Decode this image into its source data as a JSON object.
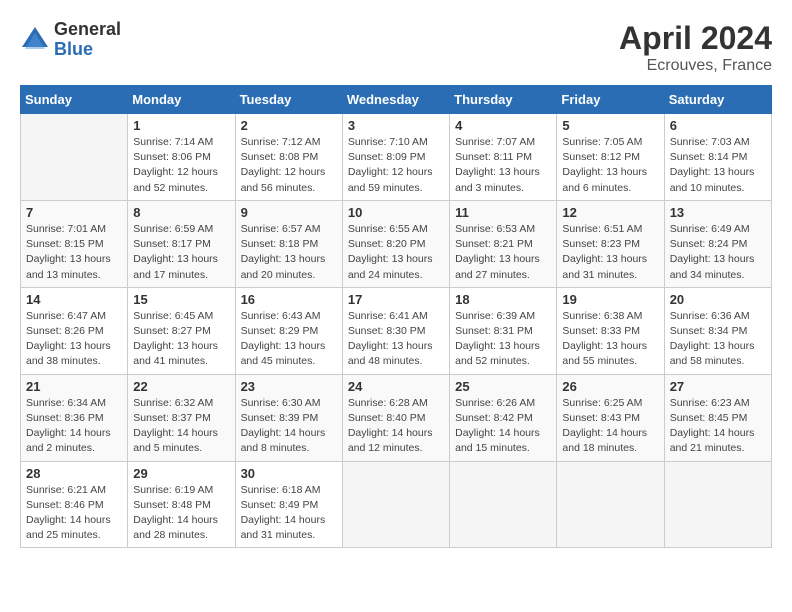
{
  "header": {
    "logo": {
      "general": "General",
      "blue": "Blue"
    },
    "title": "April 2024",
    "location": "Ecrouves, France"
  },
  "days_of_week": [
    "Sunday",
    "Monday",
    "Tuesday",
    "Wednesday",
    "Thursday",
    "Friday",
    "Saturday"
  ],
  "weeks": [
    [
      {
        "day": "",
        "info": ""
      },
      {
        "day": "1",
        "info": "Sunrise: 7:14 AM\nSunset: 8:06 PM\nDaylight: 12 hours\nand 52 minutes."
      },
      {
        "day": "2",
        "info": "Sunrise: 7:12 AM\nSunset: 8:08 PM\nDaylight: 12 hours\nand 56 minutes."
      },
      {
        "day": "3",
        "info": "Sunrise: 7:10 AM\nSunset: 8:09 PM\nDaylight: 12 hours\nand 59 minutes."
      },
      {
        "day": "4",
        "info": "Sunrise: 7:07 AM\nSunset: 8:11 PM\nDaylight: 13 hours\nand 3 minutes."
      },
      {
        "day": "5",
        "info": "Sunrise: 7:05 AM\nSunset: 8:12 PM\nDaylight: 13 hours\nand 6 minutes."
      },
      {
        "day": "6",
        "info": "Sunrise: 7:03 AM\nSunset: 8:14 PM\nDaylight: 13 hours\nand 10 minutes."
      }
    ],
    [
      {
        "day": "7",
        "info": "Sunrise: 7:01 AM\nSunset: 8:15 PM\nDaylight: 13 hours\nand 13 minutes."
      },
      {
        "day": "8",
        "info": "Sunrise: 6:59 AM\nSunset: 8:17 PM\nDaylight: 13 hours\nand 17 minutes."
      },
      {
        "day": "9",
        "info": "Sunrise: 6:57 AM\nSunset: 8:18 PM\nDaylight: 13 hours\nand 20 minutes."
      },
      {
        "day": "10",
        "info": "Sunrise: 6:55 AM\nSunset: 8:20 PM\nDaylight: 13 hours\nand 24 minutes."
      },
      {
        "day": "11",
        "info": "Sunrise: 6:53 AM\nSunset: 8:21 PM\nDaylight: 13 hours\nand 27 minutes."
      },
      {
        "day": "12",
        "info": "Sunrise: 6:51 AM\nSunset: 8:23 PM\nDaylight: 13 hours\nand 31 minutes."
      },
      {
        "day": "13",
        "info": "Sunrise: 6:49 AM\nSunset: 8:24 PM\nDaylight: 13 hours\nand 34 minutes."
      }
    ],
    [
      {
        "day": "14",
        "info": "Sunrise: 6:47 AM\nSunset: 8:26 PM\nDaylight: 13 hours\nand 38 minutes."
      },
      {
        "day": "15",
        "info": "Sunrise: 6:45 AM\nSunset: 8:27 PM\nDaylight: 13 hours\nand 41 minutes."
      },
      {
        "day": "16",
        "info": "Sunrise: 6:43 AM\nSunset: 8:29 PM\nDaylight: 13 hours\nand 45 minutes."
      },
      {
        "day": "17",
        "info": "Sunrise: 6:41 AM\nSunset: 8:30 PM\nDaylight: 13 hours\nand 48 minutes."
      },
      {
        "day": "18",
        "info": "Sunrise: 6:39 AM\nSunset: 8:31 PM\nDaylight: 13 hours\nand 52 minutes."
      },
      {
        "day": "19",
        "info": "Sunrise: 6:38 AM\nSunset: 8:33 PM\nDaylight: 13 hours\nand 55 minutes."
      },
      {
        "day": "20",
        "info": "Sunrise: 6:36 AM\nSunset: 8:34 PM\nDaylight: 13 hours\nand 58 minutes."
      }
    ],
    [
      {
        "day": "21",
        "info": "Sunrise: 6:34 AM\nSunset: 8:36 PM\nDaylight: 14 hours\nand 2 minutes."
      },
      {
        "day": "22",
        "info": "Sunrise: 6:32 AM\nSunset: 8:37 PM\nDaylight: 14 hours\nand 5 minutes."
      },
      {
        "day": "23",
        "info": "Sunrise: 6:30 AM\nSunset: 8:39 PM\nDaylight: 14 hours\nand 8 minutes."
      },
      {
        "day": "24",
        "info": "Sunrise: 6:28 AM\nSunset: 8:40 PM\nDaylight: 14 hours\nand 12 minutes."
      },
      {
        "day": "25",
        "info": "Sunrise: 6:26 AM\nSunset: 8:42 PM\nDaylight: 14 hours\nand 15 minutes."
      },
      {
        "day": "26",
        "info": "Sunrise: 6:25 AM\nSunset: 8:43 PM\nDaylight: 14 hours\nand 18 minutes."
      },
      {
        "day": "27",
        "info": "Sunrise: 6:23 AM\nSunset: 8:45 PM\nDaylight: 14 hours\nand 21 minutes."
      }
    ],
    [
      {
        "day": "28",
        "info": "Sunrise: 6:21 AM\nSunset: 8:46 PM\nDaylight: 14 hours\nand 25 minutes."
      },
      {
        "day": "29",
        "info": "Sunrise: 6:19 AM\nSunset: 8:48 PM\nDaylight: 14 hours\nand 28 minutes."
      },
      {
        "day": "30",
        "info": "Sunrise: 6:18 AM\nSunset: 8:49 PM\nDaylight: 14 hours\nand 31 minutes."
      },
      {
        "day": "",
        "info": ""
      },
      {
        "day": "",
        "info": ""
      },
      {
        "day": "",
        "info": ""
      },
      {
        "day": "",
        "info": ""
      }
    ]
  ]
}
